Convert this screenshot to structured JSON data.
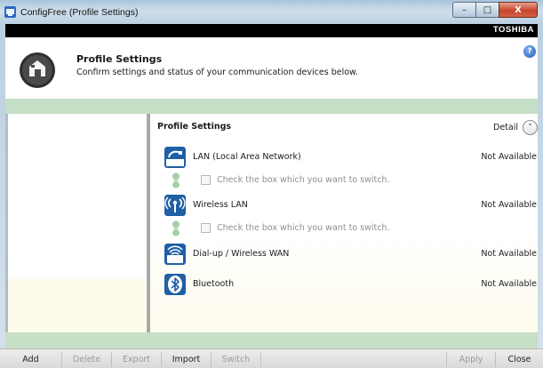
{
  "window": {
    "title": "ConfigFree (Profile Settings)",
    "controls": {
      "minimize": "–",
      "maximize": "□",
      "close": "X"
    }
  },
  "brand": {
    "label": "TOSHIBA"
  },
  "header": {
    "title": "Profile Settings",
    "subtitle": "Confirm settings and status of your communication devices below.",
    "help": "?"
  },
  "panel": {
    "title": "Profile Settings",
    "detail_label": "Detail",
    "detail_toggle": "˅",
    "devices": [
      {
        "name": "LAN (Local Area Network)",
        "status": "Not Available",
        "icon": "lan-icon"
      },
      {
        "name": "Wireless LAN",
        "status": "Not Available",
        "icon": "wireless-lan-icon"
      },
      {
        "name": "Dial-up / Wireless WAN",
        "status": "Not Available",
        "icon": "dialup-icon"
      },
      {
        "name": "Bluetooth",
        "status": "Not Available",
        "icon": "bluetooth-icon"
      }
    ],
    "switch_rows": [
      {
        "label": "Check the box which you want to switch.",
        "checked": false
      },
      {
        "label": "Check the box which you want to switch.",
        "checked": false
      }
    ]
  },
  "footer": {
    "add": "Add",
    "delete": "Delete",
    "export": "Export",
    "import": "Import",
    "switch": "Switch",
    "apply": "Apply",
    "close": "Close"
  },
  "colors": {
    "accent_green": "#c6dfc7",
    "brand_bar": "#000000",
    "icon_blue": "#1f5fa6"
  }
}
